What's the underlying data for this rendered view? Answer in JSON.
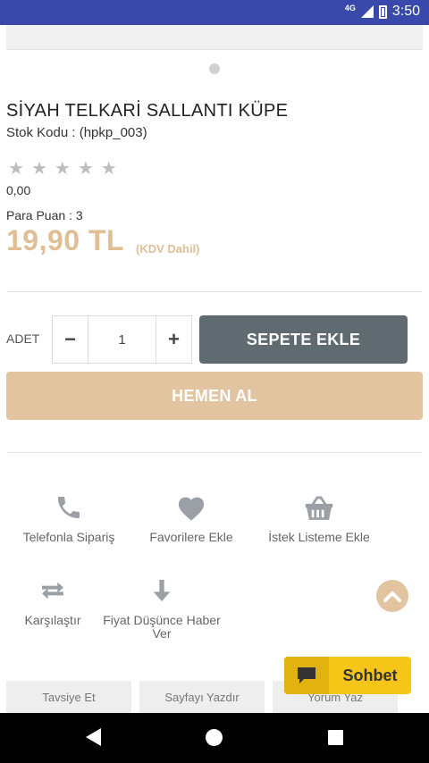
{
  "status_bar": {
    "network": "4G",
    "time": "3:50"
  },
  "product": {
    "title": "SİYAH TELKARİ SALLANTI KÜPE",
    "stock_code": "Stok Kodu : (hpkp_003)",
    "rating_value": "0,00",
    "stars_total": 5,
    "points": "Para Puan : 3",
    "price": "19,90 TL",
    "vat_note": "(KDV Dahil)"
  },
  "purchase": {
    "quantity_label": "ADET",
    "decrement": "−",
    "quantity_value": "1",
    "increment": "+",
    "add_to_cart": "SEPETE EKLE",
    "buy_now": "HEMEN AL"
  },
  "actions": {
    "phone_order": "Telefonla Sipariş",
    "favorites": "Favorilere Ekle",
    "wishlist": "İstek Listeme Ekle",
    "compare": "Karşılaştır",
    "price_alert": "Fiyat Düşünce Haber Ver"
  },
  "chat": {
    "label": "Sohbet"
  },
  "bottom_tabs": [
    "Tavsiye Et",
    "Sayfayı Yazdır",
    "Yorum Yaz"
  ],
  "colors": {
    "accent": "#e0bf95",
    "button_dark": "#5f6b70",
    "chat": "#f5c518",
    "status_bar": "#3949ab"
  },
  "icons": {
    "phone": "phone-icon",
    "favorites": "heart-icon",
    "wishlist": "basket-icon",
    "compare": "swap-arrows-icon",
    "price_alert": "arrow-down-icon",
    "scroll_top": "chevron-up-icon",
    "chat": "chat-bubble-icon"
  }
}
